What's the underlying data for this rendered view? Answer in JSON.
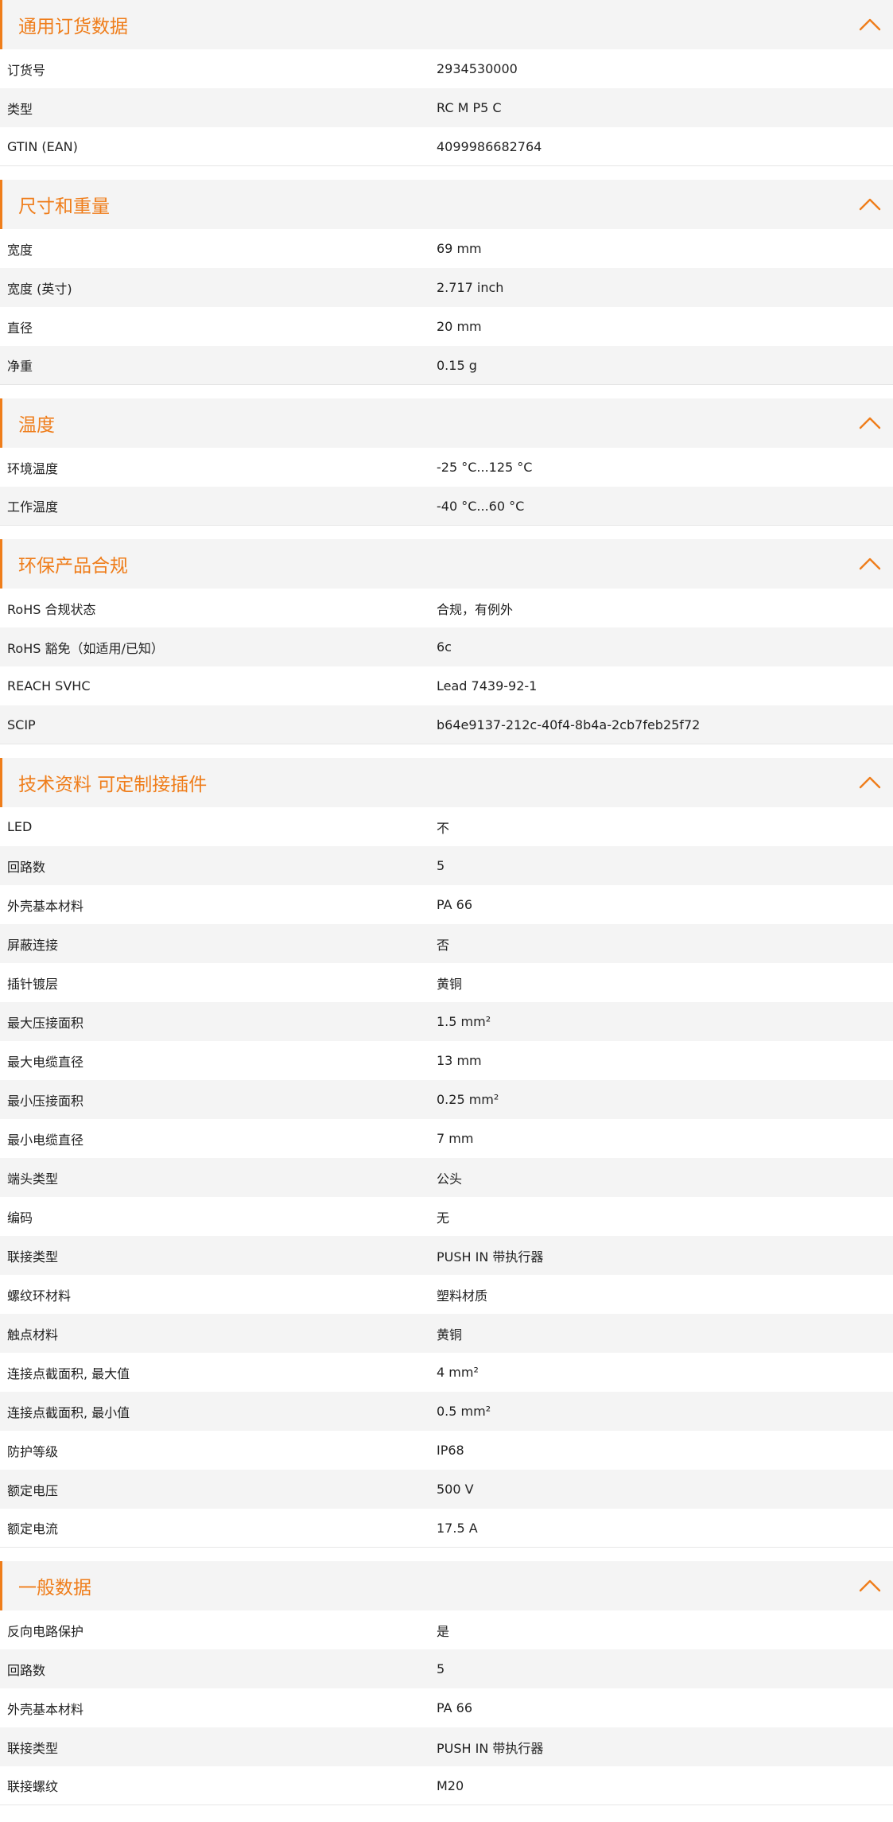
{
  "accent_color": "#ef7d1a",
  "sections": [
    {
      "title": "通用订货数据",
      "toggle_icon": "chevron-up-icon",
      "rows": [
        {
          "label": "订货号",
          "value": "2934530000"
        },
        {
          "label": "类型",
          "value": "RC M P5 C"
        },
        {
          "label": "GTIN (EAN)",
          "value": "4099986682764"
        }
      ]
    },
    {
      "title": "尺寸和重量",
      "toggle_icon": "chevron-up-icon",
      "rows": [
        {
          "label": "宽度",
          "value": "69  mm"
        },
        {
          "label": "宽度 (英寸)",
          "value": "2.717  inch"
        },
        {
          "label": "直径",
          "value": "20  mm"
        },
        {
          "label": "净重",
          "value": "0.15  g"
        }
      ]
    },
    {
      "title": "温度",
      "toggle_icon": "chevron-up-icon",
      "rows": [
        {
          "label": "环境温度",
          "value": "-25 °C...125 °C"
        },
        {
          "label": "工作温度",
          "value": "-40 °C...60 °C"
        }
      ]
    },
    {
      "title": "环保产品合规",
      "toggle_icon": "chevron-up-icon",
      "rows": [
        {
          "label": "RoHS 合规状态",
          "value": "合规，有例外"
        },
        {
          "label": "RoHS 豁免（如适用/已知）",
          "value": "6c"
        },
        {
          "label": "REACH SVHC",
          "value": "Lead 7439-92-1"
        },
        {
          "label": "SCIP",
          "value": "b64e9137-212c-40f4-8b4a-2cb7feb25f72"
        }
      ]
    },
    {
      "title": "技术资料 可定制接插件",
      "toggle_icon": "chevron-up-icon",
      "rows": [
        {
          "label": "LED",
          "value": "不"
        },
        {
          "label": "回路数",
          "value": "5"
        },
        {
          "label": "外壳基本材料",
          "value": "PA 66"
        },
        {
          "label": "屏蔽连接",
          "value": "否"
        },
        {
          "label": "插针镀层",
          "value": "黄铜"
        },
        {
          "label": "最大压接面积",
          "value": "1.5  mm²"
        },
        {
          "label": "最大电缆直径",
          "value": "13  mm"
        },
        {
          "label": "最小压接面积",
          "value": "0.25  mm²"
        },
        {
          "label": "最小电缆直径",
          "value": "7  mm"
        },
        {
          "label": "端头类型",
          "value": "公头"
        },
        {
          "label": "编码",
          "value": "无"
        },
        {
          "label": "联接类型",
          "value": "PUSH IN 带执行器"
        },
        {
          "label": "螺纹环材料",
          "value": "塑料材质"
        },
        {
          "label": "触点材料",
          "value": "黄铜"
        },
        {
          "label": "连接点截面积, 最大值",
          "value": "4  mm²"
        },
        {
          "label": "连接点截面积, 最小值",
          "value": "0.5  mm²"
        },
        {
          "label": "防护等级",
          "value": "IP68"
        },
        {
          "label": "额定电压",
          "value": "500  V"
        },
        {
          "label": "额定电流",
          "value": "17.5  A"
        }
      ]
    },
    {
      "title": "一般数据",
      "toggle_icon": "chevron-up-icon",
      "rows": [
        {
          "label": "反向电路保护",
          "value": "是"
        },
        {
          "label": "回路数",
          "value": "5"
        },
        {
          "label": "外壳基本材料",
          "value": "PA 66"
        },
        {
          "label": "联接类型",
          "value": "PUSH IN 带执行器"
        },
        {
          "label": "联接螺纹",
          "value": "M20"
        }
      ]
    }
  ]
}
